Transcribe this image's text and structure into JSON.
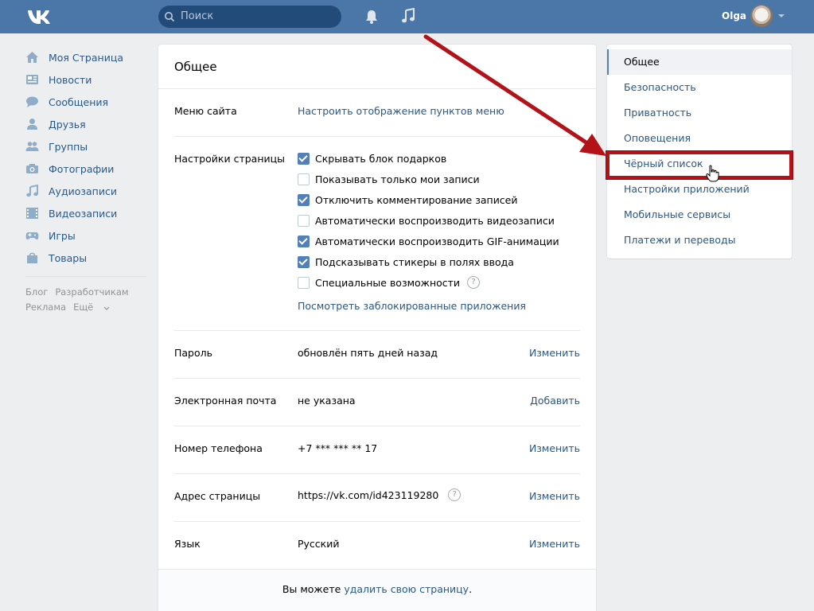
{
  "header": {
    "logo_text": "VK",
    "search_placeholder": "Поиск",
    "user_name": "Olga"
  },
  "leftnav": {
    "items": [
      {
        "label": "Моя Страница",
        "icon": "home-icon"
      },
      {
        "label": "Новости",
        "icon": "news-icon"
      },
      {
        "label": "Сообщения",
        "icon": "messages-icon"
      },
      {
        "label": "Друзья",
        "icon": "friends-icon"
      },
      {
        "label": "Группы",
        "icon": "groups-icon"
      },
      {
        "label": "Фотографии",
        "icon": "camera-icon"
      },
      {
        "label": "Аудиозаписи",
        "icon": "music-icon"
      },
      {
        "label": "Видеозаписи",
        "icon": "video-icon"
      },
      {
        "label": "Игры",
        "icon": "gamepad-icon"
      },
      {
        "label": "Товары",
        "icon": "shopping-bag-icon"
      }
    ],
    "footer": {
      "blog": "Блог",
      "developers": "Разработчикам",
      "ads": "Реклама",
      "more": "Ещё"
    }
  },
  "main": {
    "title": "Общее",
    "menu_label": "Меню сайта",
    "menu_link": "Настроить отображение пунктов меню",
    "page_settings_label": "Настройки страницы",
    "checkboxes": [
      {
        "label": "Скрывать блок подарков",
        "checked": true
      },
      {
        "label": "Показывать только мои записи",
        "checked": false
      },
      {
        "label": "Отключить комментирование записей",
        "checked": true
      },
      {
        "label": "Автоматически воспроизводить видеозаписи",
        "checked": false
      },
      {
        "label": "Автоматически воспроизводить GIF-анимации",
        "checked": true
      },
      {
        "label": "Подсказывать стикеры в полях ввода",
        "checked": true
      },
      {
        "label": "Специальные возможности",
        "checked": false
      }
    ],
    "help_glyph": "?",
    "blocked_apps_link": "Посмотреть заблокированные приложения",
    "password": {
      "label": "Пароль",
      "value": "обновлён пять дней назад",
      "action": "Изменить"
    },
    "email": {
      "label": "Электронная почта",
      "value": "не указана",
      "action": "Добавить"
    },
    "phone": {
      "label": "Номер телефона",
      "value": "+7 *** *** ** 17",
      "action": "Изменить"
    },
    "address": {
      "label": "Адрес страницы",
      "value": "https://vk.com/id423119280",
      "action": "Изменить"
    },
    "language": {
      "label": "Язык",
      "value": "Русский",
      "action": "Изменить"
    },
    "delete_prefix": "Вы можете ",
    "delete_link": "удалить свою страницу",
    "delete_suffix": "."
  },
  "rightmenu": {
    "items": [
      {
        "label": "Общее",
        "active": true
      },
      {
        "label": "Безопасность"
      },
      {
        "label": "Приватность"
      },
      {
        "label": "Оповещения"
      },
      {
        "label": "Чёрный список"
      },
      {
        "label": "Настройки приложений"
      },
      {
        "label": "Мобильные сервисы"
      },
      {
        "label": "Платежи и переводы"
      }
    ]
  },
  "colors": {
    "header": "#4a76a8",
    "link": "#2a5885",
    "checkbox": "#5181b8",
    "annotation_red": "#b31218",
    "background": "#edeef0"
  }
}
